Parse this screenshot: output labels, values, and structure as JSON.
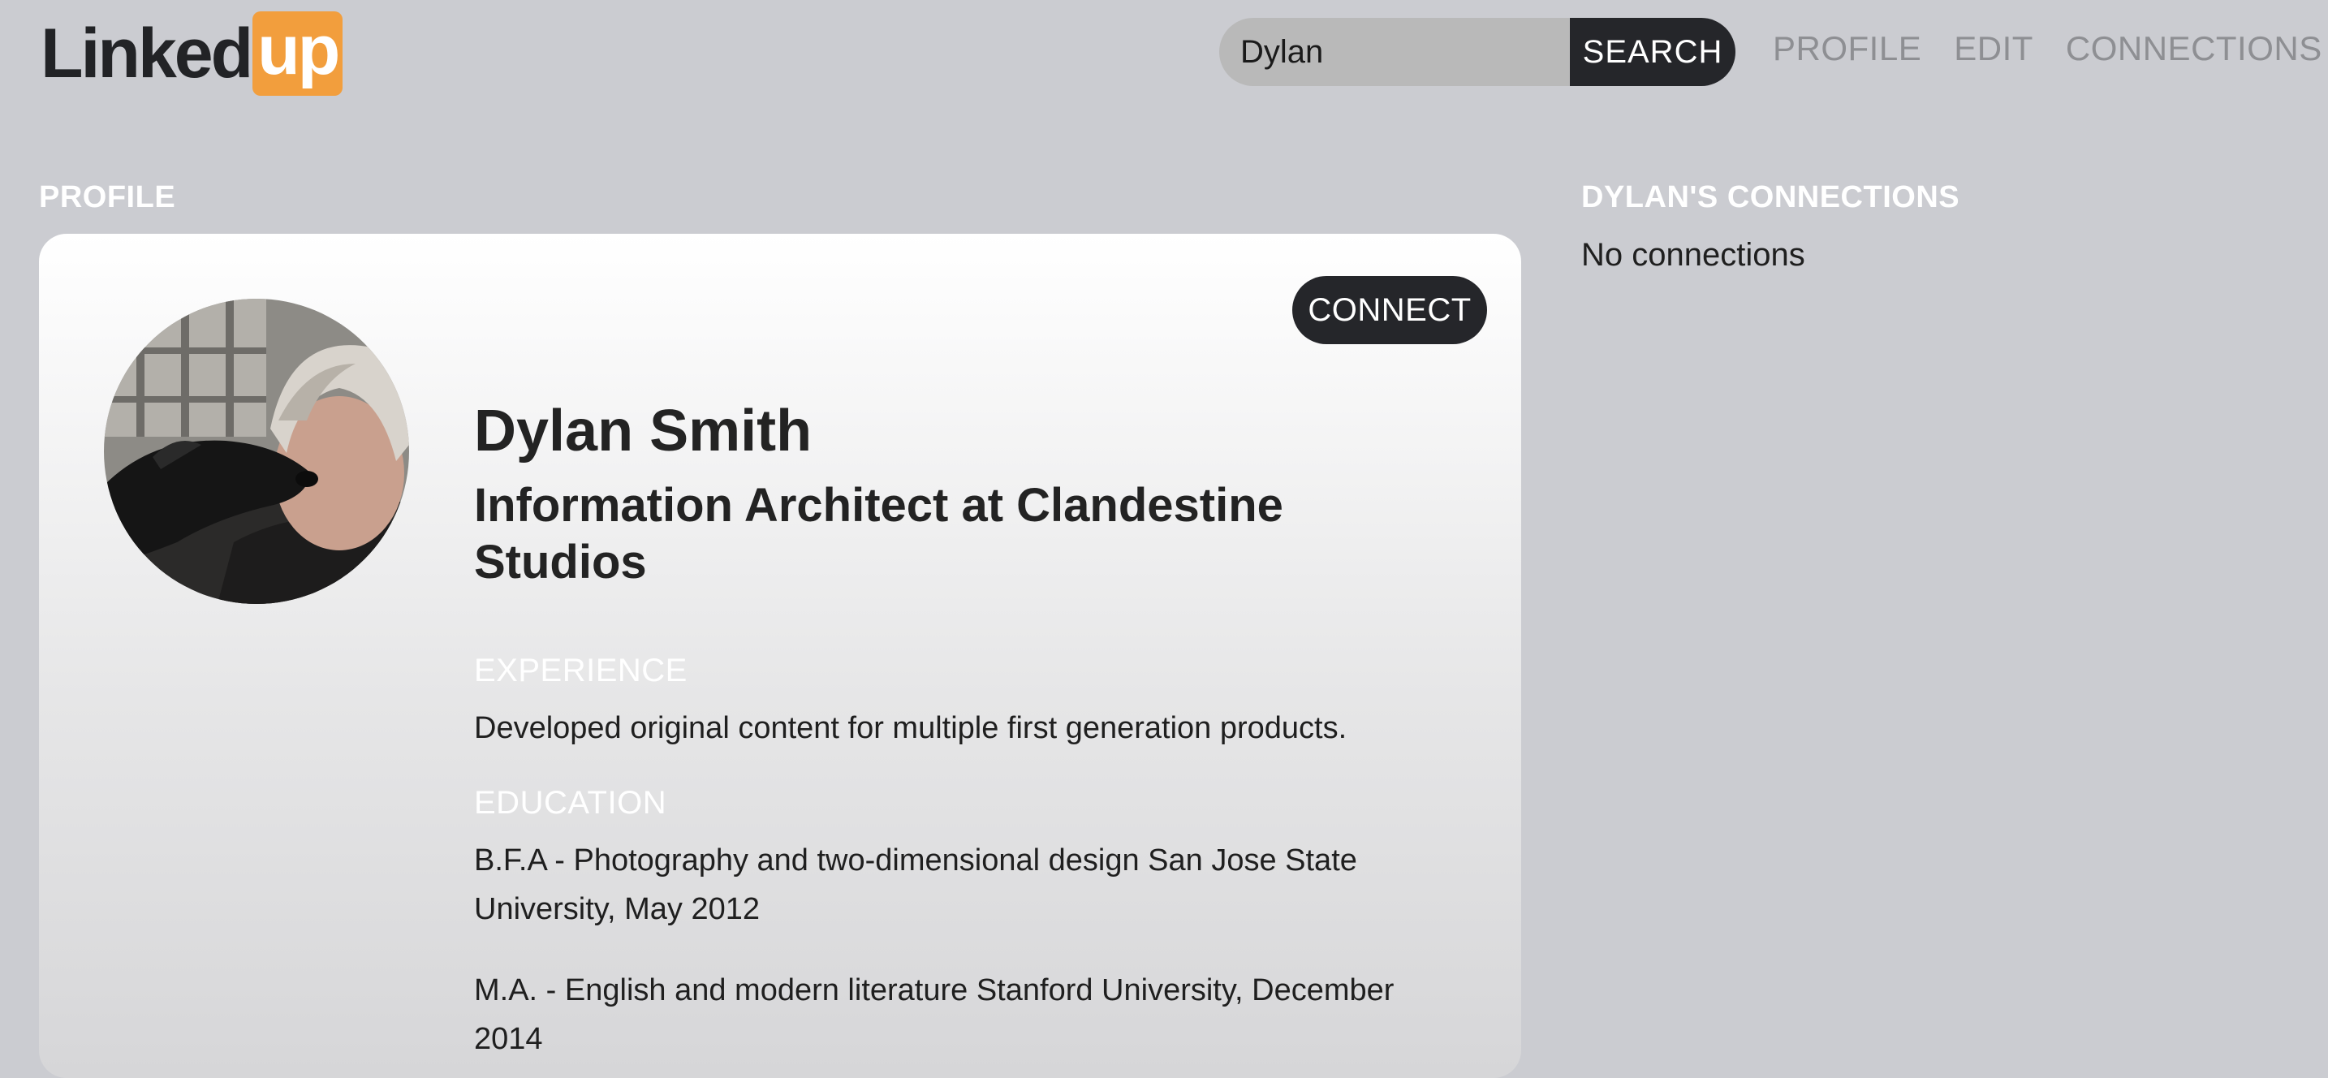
{
  "header": {
    "logo_main": "Linked",
    "logo_box": "up",
    "search": {
      "value": "Dylan",
      "placeholder": "",
      "button_label": "SEARCH"
    },
    "nav": [
      {
        "label": "PROFILE"
      },
      {
        "label": "EDIT"
      },
      {
        "label": "CONNECTIONS"
      }
    ]
  },
  "profile": {
    "section_title": "PROFILE",
    "connect_label": "CONNECT",
    "name": "Dylan Smith",
    "headline": "Information Architect at Clandestine Studios",
    "experience_title": "EXPERIENCE",
    "experience": "Developed original content for multiple first generation products.",
    "education_title": "EDUCATION",
    "education": [
      "B.F.A - Photography and two-dimensional design San Jose State University, May 2012",
      "M.A. - English and modern literature Stanford University, December 2014"
    ]
  },
  "connections": {
    "title": "DYLAN'S CONNECTIONS",
    "empty_text": "No connections"
  },
  "colors": {
    "background": "#cbccd1",
    "logo_accent": "#f29e3d",
    "dark_button": "#25262a",
    "nav_text": "#8e8f93"
  }
}
